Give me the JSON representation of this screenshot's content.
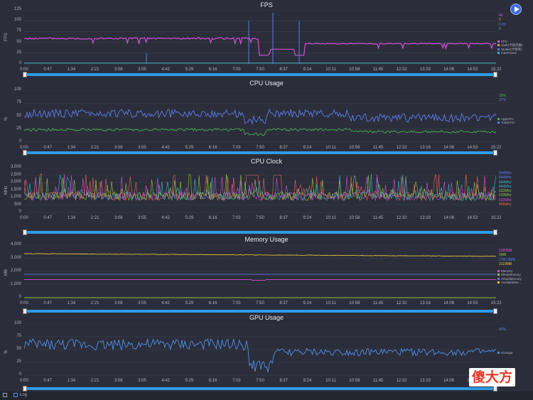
{
  "x_ticks": [
    "0:00",
    "0:47",
    "1:34",
    "2:21",
    "3:08",
    "3:55",
    "4:42",
    "5:29",
    "6:16",
    "7:03",
    "7:50",
    "8:37",
    "9:24",
    "10:11",
    "10:58",
    "11:45",
    "12:32",
    "13:19",
    "14:06",
    "14:53",
    "15:22"
  ],
  "panels": [
    {
      "key": "fps",
      "title": "FPS",
      "ylabel": "FPS",
      "yticks": [
        "125",
        "100",
        "75",
        "50",
        "25",
        "0"
      ],
      "values": [
        {
          "text": "46",
          "color": "#d24fd4"
        },
        {
          "text": "0",
          "color": "#e0a03a"
        },
        {
          "text": "0.00",
          "color": "#5d7be8"
        },
        {
          "text": "0",
          "color": "#3fb3c9"
        }
      ],
      "legend": [
        {
          "text": "FPS",
          "color": "#d24fd4"
        },
        {
          "text": "Jank(卡顿次数)",
          "color": "#e0a03a"
        },
        {
          "text": "Stutter(卡顿率)",
          "color": "#5d7be8"
        },
        {
          "text": "InterFrame",
          "color": "#3fb3c9"
        }
      ]
    },
    {
      "key": "cpu",
      "title": "CPU Usage",
      "ylabel": "%",
      "yticks": [
        "100",
        "75",
        "50",
        "25",
        "0"
      ],
      "values": [
        {
          "text": "15%",
          "color": "#47b04f"
        },
        {
          "text": "37%",
          "color": "#5d7be8"
        }
      ],
      "legend": [
        {
          "text": "AppCPU",
          "color": "#47b04f"
        },
        {
          "text": "TotalCPU",
          "color": "#5d7be8"
        }
      ]
    },
    {
      "key": "clock",
      "title": "CPU Clock",
      "ylabel": "MHz",
      "yticks": [
        "3,000",
        "2,500",
        "2,000",
        "1,500",
        "1,000",
        "500",
        "0"
      ],
      "values": [
        {
          "text": "844Mhz",
          "color": "#5d7be8"
        },
        {
          "text": "844Mhz",
          "color": "#5d7be8"
        },
        {
          "text": "844Mhz",
          "color": "#3fb3c9"
        },
        {
          "text": "844Mhz",
          "color": "#3fb3c9"
        },
        {
          "text": "633Mhz",
          "color": "#8fc43f"
        },
        {
          "text": "633Mhz",
          "color": "#8fc43f"
        },
        {
          "text": "633Mhz",
          "color": "#d24fd4"
        },
        {
          "text": "806Mhz",
          "color": "#e8674f"
        }
      ],
      "legend": []
    },
    {
      "key": "memory",
      "title": "Memory Usage",
      "ylabel": "MB",
      "yticks": [
        "4,000",
        "3,000",
        "2,000",
        "1,000",
        "0"
      ],
      "values": [
        {
          "text": "1386MB",
          "color": "#d24fd4"
        },
        {
          "text": "0MB",
          "color": "#8fc43f"
        },
        {
          "text": "1780.5MB",
          "color": "#5d7be8"
        },
        {
          "text": "3119MB",
          "color": "#e8c03a"
        }
      ],
      "legend": [
        {
          "text": "Memory",
          "color": "#d24fd4"
        },
        {
          "text": "SleepMemory",
          "color": "#8fc43f"
        },
        {
          "text": "VirtualMemory",
          "color": "#5d7be8"
        },
        {
          "text": "AvailableMe...",
          "color": "#e8c03a"
        }
      ]
    },
    {
      "key": "gpu",
      "title": "GPU Usage",
      "ylabel": "%",
      "yticks": [
        "100",
        "75",
        "50",
        "25",
        "0"
      ],
      "values": [
        {
          "text": "42%",
          "color": "#4f8fe8"
        }
      ],
      "legend": [
        {
          "text": "GUsage",
          "color": "#4f8fe8"
        }
      ]
    }
  ],
  "footer": {
    "log_label": "Log"
  },
  "watermark": {
    "text": "傻大方"
  },
  "colors": {
    "slider": "#2e9be6",
    "background": "#2b2e3a"
  }
}
